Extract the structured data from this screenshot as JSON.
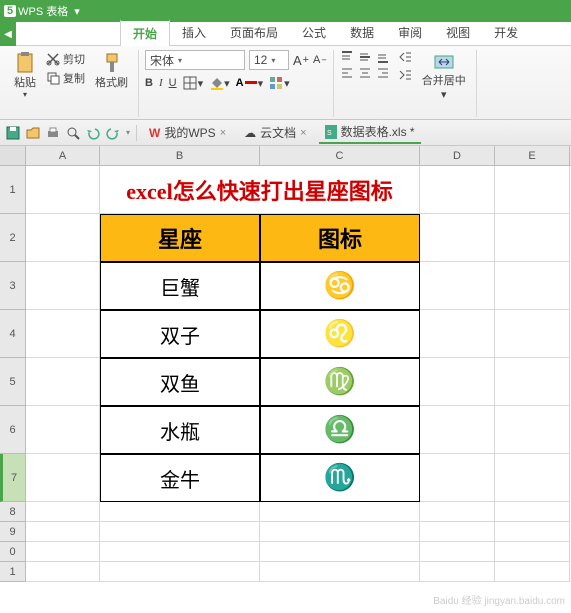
{
  "titlebar": {
    "appname": "WPS 表格",
    "badge": "5"
  },
  "tabs": {
    "active": "开始",
    "items": [
      "开始",
      "插入",
      "页面布局",
      "公式",
      "数据",
      "审阅",
      "视图",
      "开发"
    ]
  },
  "ribbon": {
    "clipboard": {
      "paste": "粘贴",
      "cut": "剪切",
      "copy": "复制",
      "format_painter": "格式刷"
    },
    "font": {
      "name": "宋体",
      "size": "12",
      "bold": "B",
      "italic": "I",
      "underline": "U"
    },
    "align": {
      "wrap": "合并居中"
    }
  },
  "doctabs": {
    "mywps": "我的WPS",
    "cloud": "云文档",
    "file": "数据表格.xls *"
  },
  "columns": [
    "A",
    "B",
    "C",
    "D",
    "E"
  ],
  "rows_small": [
    "8",
    "9",
    "0",
    "1"
  ],
  "sheet": {
    "title": "excel怎么快速打出星座图标",
    "header": {
      "col1": "星座",
      "col2": "图标"
    },
    "data": [
      {
        "name": "巨蟹",
        "symbol": "♋"
      },
      {
        "name": "双子",
        "symbol": "♌"
      },
      {
        "name": "双鱼",
        "symbol": "♍"
      },
      {
        "name": "水瓶",
        "symbol": "♎"
      },
      {
        "name": "金牛",
        "symbol": "♏"
      }
    ],
    "row_numbers": [
      "1",
      "2",
      "3",
      "4",
      "5",
      "6",
      "7"
    ]
  },
  "watermark": "Baidu 经验  jingyan.baidu.com"
}
